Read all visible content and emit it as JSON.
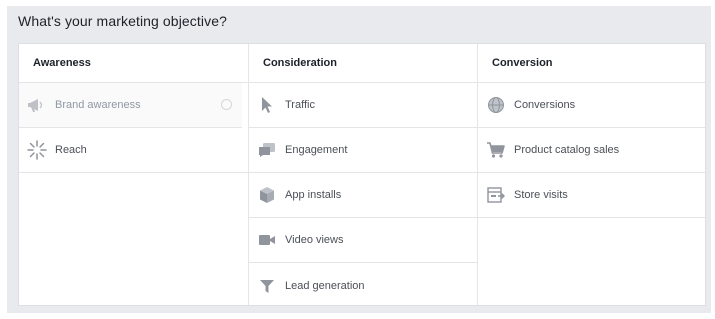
{
  "title": "What's your marketing objective?",
  "columns": [
    {
      "heading": "Awareness",
      "items": [
        {
          "label": "Brand awareness",
          "icon": "megaphone-icon",
          "state": "disabled"
        },
        {
          "label": "Reach",
          "icon": "burst-icon",
          "state": "normal"
        }
      ]
    },
    {
      "heading": "Consideration",
      "items": [
        {
          "label": "Traffic",
          "icon": "cursor-icon"
        },
        {
          "label": "Engagement",
          "icon": "chat-bubbles-icon"
        },
        {
          "label": "App installs",
          "icon": "cube-icon"
        },
        {
          "label": "Video views",
          "icon": "video-camera-icon"
        },
        {
          "label": "Lead generation",
          "icon": "funnel-icon"
        }
      ]
    },
    {
      "heading": "Conversion",
      "items": [
        {
          "label": "Conversions",
          "icon": "globe-icon"
        },
        {
          "label": "Product catalog sales",
          "icon": "shopping-cart-icon"
        },
        {
          "label": "Store visits",
          "icon": "store-icon"
        }
      ]
    }
  ],
  "colors": {
    "panel_bg": "#e9eaed",
    "icon": "#90949c",
    "text": "#4b4f56",
    "disabled_text": "#9197a3"
  }
}
